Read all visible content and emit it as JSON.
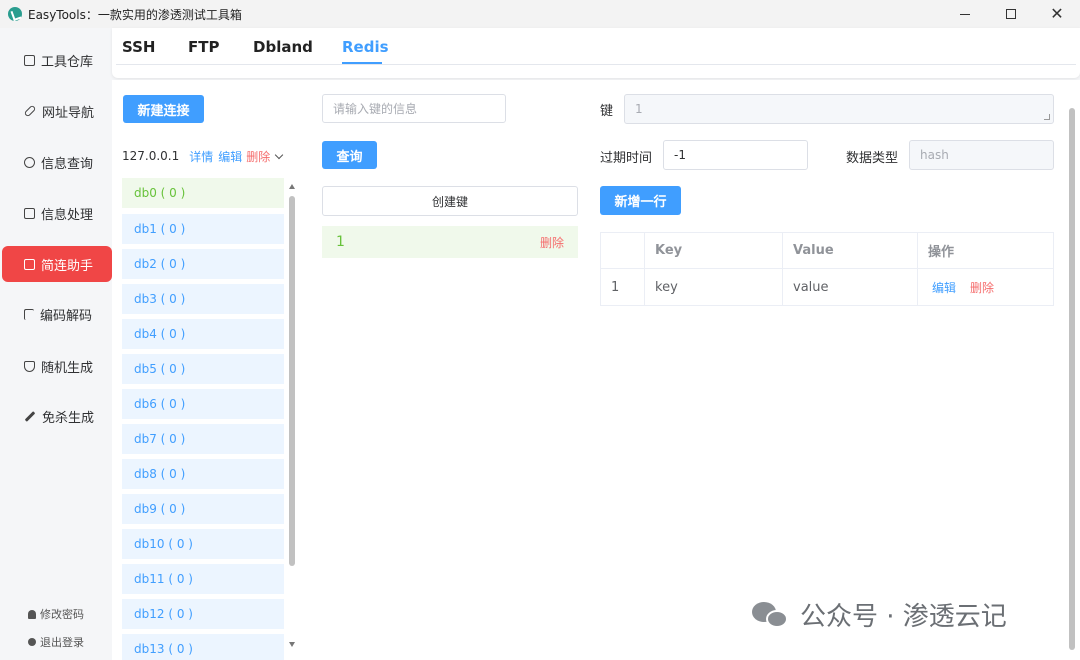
{
  "window": {
    "title": "EasyTools：一款实用的渗透测试工具箱",
    "minimize_glyph": "",
    "close_glyph": "✕"
  },
  "sidebar": {
    "items": [
      {
        "label": "工具仓库",
        "icon": "box-icon"
      },
      {
        "label": "网址导航",
        "icon": "link-icon"
      },
      {
        "label": "信息查询",
        "icon": "search-icon"
      },
      {
        "label": "信息处理",
        "icon": "edit-icon"
      },
      {
        "label": "简连助手",
        "icon": "connect-icon",
        "active": true
      },
      {
        "label": "编码解码",
        "icon": "flag-icon"
      },
      {
        "label": "随机生成",
        "icon": "shield-icon"
      },
      {
        "label": "免杀生成",
        "icon": "pen-icon"
      }
    ],
    "change_password": "修改密码",
    "logout": "退出登录"
  },
  "tabs": [
    {
      "label": "SSH"
    },
    {
      "label": "FTP"
    },
    {
      "label": "Dbland"
    },
    {
      "label": "Redis",
      "active": true
    }
  ],
  "redis": {
    "new_connection_label": "新建连接",
    "connection": {
      "host": "127.0.0.1",
      "detail_label": "详情",
      "edit_label": "编辑",
      "delete_label": "删除"
    },
    "databases": [
      "db0 ( 0 )",
      "db1 ( 0 )",
      "db2 ( 0 )",
      "db3 ( 0 )",
      "db4 ( 0 )",
      "db5 ( 0 )",
      "db6 ( 0 )",
      "db7 ( 0 )",
      "db8 ( 0 )",
      "db9 ( 0 )",
      "db10 ( 0 )",
      "db11 ( 0 )",
      "db12 ( 0 )",
      "db13 ( 0 )"
    ],
    "key_search_placeholder": "请输入键的信息",
    "query_label": "查询",
    "create_key_label": "创建键",
    "keys": [
      {
        "name": "1",
        "delete_label": "删除"
      }
    ],
    "detail": {
      "key_label": "键",
      "key_value": "1",
      "ttl_label": "过期时间",
      "ttl_value": "-1",
      "type_label": "数据类型",
      "type_value": "hash",
      "add_row_label": "新增一行"
    },
    "table": {
      "headers": [
        "",
        "Key",
        "Value",
        "操作"
      ],
      "rows": [
        {
          "index": "1",
          "key": "key",
          "value": "value",
          "edit_label": "编辑",
          "delete_label": "删除"
        }
      ]
    }
  },
  "watermark": {
    "text": "公众号 · 渗透云记"
  }
}
